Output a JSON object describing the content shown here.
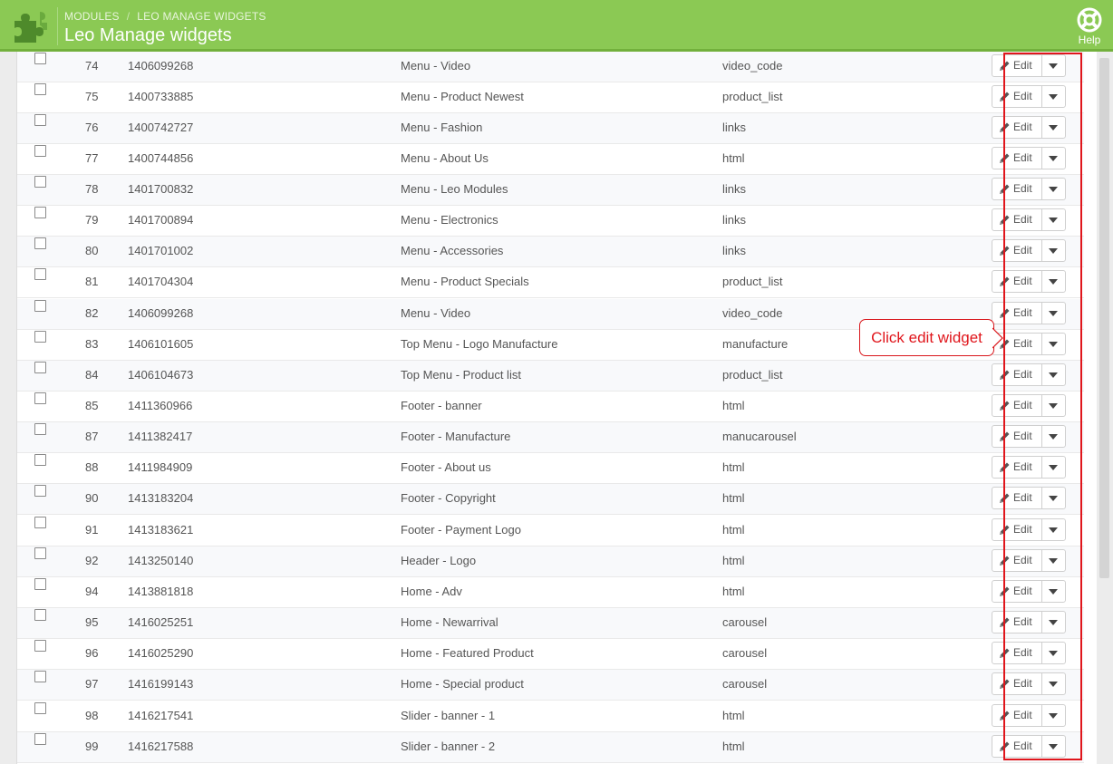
{
  "header": {
    "breadcrumb": [
      "MODULES",
      "LEO MANAGE WIDGETS"
    ],
    "title": "Leo Manage widgets",
    "help_label": "Help",
    "color": "#8bc954"
  },
  "table": {
    "edit_label": "Edit",
    "rows": [
      {
        "id": "74",
        "key": "1406099268",
        "name": "Menu - Video",
        "type": "video_code"
      },
      {
        "id": "75",
        "key": "1400733885",
        "name": "Menu - Product Newest",
        "type": "product_list"
      },
      {
        "id": "76",
        "key": "1400742727",
        "name": "Menu - Fashion",
        "type": "links"
      },
      {
        "id": "77",
        "key": "1400744856",
        "name": "Menu - About Us",
        "type": "html"
      },
      {
        "id": "78",
        "key": "1401700832",
        "name": "Menu - Leo Modules",
        "type": "links"
      },
      {
        "id": "79",
        "key": "1401700894",
        "name": "Menu - Electronics",
        "type": "links"
      },
      {
        "id": "80",
        "key": "1401701002",
        "name": "Menu - Accessories",
        "type": "links"
      },
      {
        "id": "81",
        "key": "1401704304",
        "name": "Menu - Product Specials",
        "type": "product_list"
      },
      {
        "id": "82",
        "key": "1406099268",
        "name": "Menu - Video",
        "type": "video_code"
      },
      {
        "id": "83",
        "key": "1406101605",
        "name": "Top Menu - Logo Manufacture",
        "type": "manufacture"
      },
      {
        "id": "84",
        "key": "1406104673",
        "name": "Top Menu - Product list",
        "type": "product_list"
      },
      {
        "id": "85",
        "key": "1411360966",
        "name": "Footer - banner",
        "type": "html"
      },
      {
        "id": "87",
        "key": "1411382417",
        "name": "Footer - Manufacture",
        "type": "manucarousel"
      },
      {
        "id": "88",
        "key": "1411984909",
        "name": "Footer - About us",
        "type": "html"
      },
      {
        "id": "90",
        "key": "1413183204",
        "name": "Footer - Copyright",
        "type": "html"
      },
      {
        "id": "91",
        "key": "1413183621",
        "name": "Footer - Payment Logo",
        "type": "html"
      },
      {
        "id": "92",
        "key": "1413250140",
        "name": "Header - Logo",
        "type": "html"
      },
      {
        "id": "94",
        "key": "1413881818",
        "name": "Home - Adv",
        "type": "html"
      },
      {
        "id": "95",
        "key": "1416025251",
        "name": "Home - Newarrival",
        "type": "carousel"
      },
      {
        "id": "96",
        "key": "1416025290",
        "name": "Home - Featured Product",
        "type": "carousel"
      },
      {
        "id": "97",
        "key": "1416199143",
        "name": "Home - Special product",
        "type": "carousel"
      },
      {
        "id": "98",
        "key": "1416217541",
        "name": "Slider - banner - 1",
        "type": "html"
      },
      {
        "id": "99",
        "key": "1416217588",
        "name": "Slider - banner - 2",
        "type": "html"
      }
    ]
  },
  "annotation": {
    "callout_text": "Click edit widget",
    "color": "#e0161c"
  }
}
